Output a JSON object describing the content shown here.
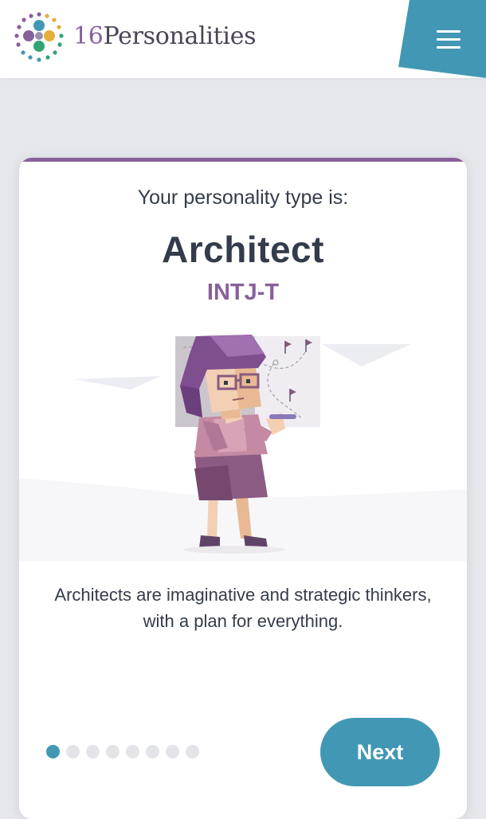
{
  "header": {
    "brand_number": "16",
    "brand_word": "Personalities",
    "menu_icon": "hamburger-menu-icon",
    "accent_color": "#4298b4"
  },
  "result": {
    "subtitle": "Your personality type is:",
    "type_name": "Architect",
    "type_code": "INTJ-T",
    "illustration": "architect-character-illustration",
    "description": "Architects are imaginative and strategic thinkers, with a plan for everything.",
    "type_color": "#88619a"
  },
  "pagination": {
    "total": 8,
    "current": 1,
    "active_color": "#4298b4"
  },
  "actions": {
    "next_label": "Next"
  }
}
